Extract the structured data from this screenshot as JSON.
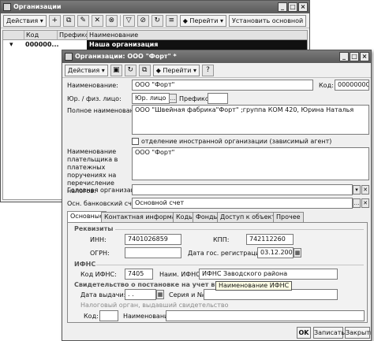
{
  "back_window": {
    "title": "Организации",
    "toolbar": {
      "actions": "Действия",
      "goto": "Перейти",
      "set_main": "Установить основной"
    },
    "columns": [
      "Код",
      "Префикс",
      "Наименование"
    ],
    "rows": [
      {
        "code": "000000...",
        "prefix": "",
        "name": "Наша организация"
      }
    ]
  },
  "form": {
    "title": "Организации: ООО \"Форт\" *",
    "toolbar": {
      "actions": "Действия",
      "goto": "Перейти"
    },
    "labels": {
      "name": "Наименование:",
      "code": "Код:",
      "legal_type": "Юр. / физ. лицо:",
      "prefix": "Префикс:",
      "full_name": "Полное наименование:",
      "payer_name": "Наименование плательщика в платежных поручениях на перечисление налогов:",
      "head_org": "Головная организация:",
      "bank_account": "Осн. банковский счет:"
    },
    "values": {
      "name": "ООО \"Форт\"",
      "code": "000000001",
      "legal_type": "Юр. лицо",
      "prefix": "",
      "full_name": "ООО \"Швейная фабрика\"Форт\" ;группа КОМ 420, Юрина Наталья",
      "payer_name": "ООО \"Форт\"",
      "head_org": "",
      "bank_account": "Основной счет"
    },
    "foreign_checkbox_label": "отделение иностранной организации (зависимый агент)",
    "tabs": [
      "Основные",
      "Контактная информация",
      "Коды",
      "Фонды",
      "Доступ к объектам",
      "Прочее"
    ],
    "requisites": {
      "section": "Реквизиты",
      "inn_label": "ИНН:",
      "inn": "7401026859",
      "kpp_label": "КПП:",
      "kpp": "742112260",
      "ogrn_label": "ОГРН:",
      "ogrn": "",
      "reg_date_label": "Дата гос. регистрации:",
      "reg_date": "03.12.2007"
    },
    "ifns": {
      "section": "ИФНС",
      "code_label": "Код ИФНС:",
      "code": "7405",
      "name_label": "Наим. ИФНС:",
      "name": "ИФНС Заводского района"
    },
    "certificate": {
      "section": "Свидетельство о постановке на учет в налоговом органе",
      "date_label": "Дата выдачи:",
      "date": ". .",
      "series_label": "Серия и №:",
      "series": "",
      "authority_label": "Налоговый орган, выдавший свидетельство",
      "code_label": "Код:",
      "code": "",
      "name_label": "Наименование:",
      "name": ""
    },
    "tooltip": "Наименование ИФНС",
    "buttons": {
      "ok": "OK",
      "save": "Записать",
      "close": "Закрыть"
    }
  }
}
